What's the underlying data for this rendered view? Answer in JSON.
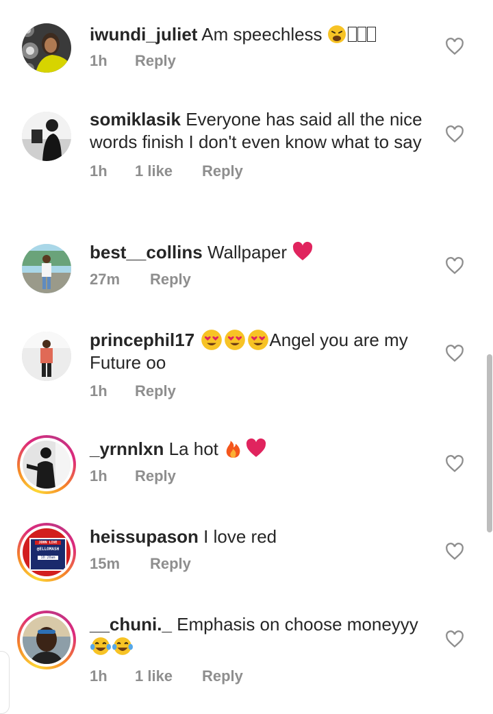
{
  "comments": [
    {
      "username": "iwundi_juliet",
      "text": "Am speechless ",
      "emoji": [
        "weary-face",
        "tofu",
        "tofu",
        "tofu"
      ],
      "time": "1h",
      "likes": "",
      "reply": "Reply"
    },
    {
      "username": "somiklasik",
      "text": "Everyone has said all the nice words finish I don't even know what to say",
      "emoji": [],
      "time": "1h",
      "likes": "1 like",
      "reply": "Reply"
    },
    {
      "username": "best__collins",
      "text": "Wallpaper ",
      "emoji": [
        "red-heart"
      ],
      "time": "27m",
      "likes": "",
      "reply": "Reply"
    },
    {
      "username": "princephil17",
      "text": "Angel you are my Future oo",
      "emoji": [
        "heart-eyes",
        "heart-eyes",
        "heart-eyes"
      ],
      "time": "1h",
      "likes": "",
      "reply": "Reply"
    },
    {
      "username": "_yrnnlxn",
      "text": "La hot ",
      "emoji": [
        "fire",
        "red-heart"
      ],
      "time": "1h",
      "likes": "",
      "reply": "Reply"
    },
    {
      "username": "heissupason",
      "text": "I love red",
      "emoji": [],
      "time": "15m",
      "likes": "",
      "reply": "Reply"
    },
    {
      "username": "__chuni._",
      "text": "Emphasis on choose moneyyy",
      "emoji": [
        "tears-of-joy",
        "tears-of-joy"
      ],
      "time": "1h",
      "likes": "1 like",
      "reply": "Reply"
    }
  ],
  "avatar_badge": {
    "line1": "JOHN LIVE",
    "line2": "@ELLOMASH",
    "line3": "10:20am"
  },
  "colors": {
    "text": "#262626",
    "meta": "#8e8e8e",
    "heart": "#e0245e"
  }
}
